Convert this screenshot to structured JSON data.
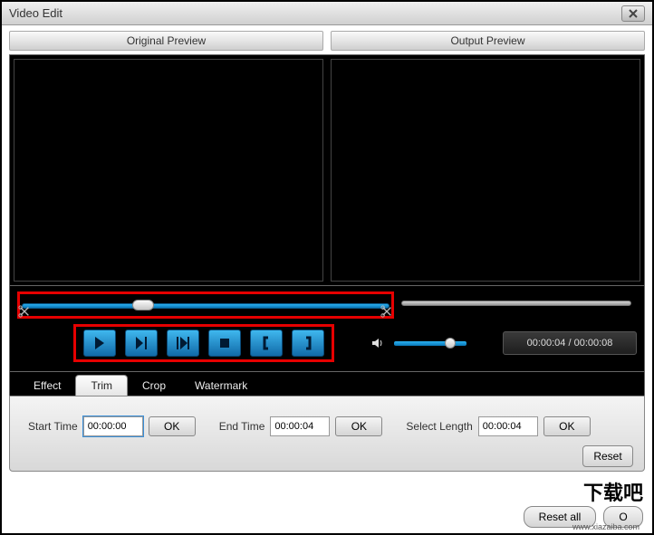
{
  "window": {
    "title": "Video Edit"
  },
  "preview": {
    "original_label": "Original Preview",
    "output_label": "Output Preview"
  },
  "playback": {
    "time_display": "00:00:04 / 00:00:08"
  },
  "tabs": {
    "effect": "Effect",
    "trim": "Trim",
    "crop": "Crop",
    "watermark": "Watermark"
  },
  "trim": {
    "start_label": "Start Time",
    "start_value": "00:00:00",
    "end_label": "End Time",
    "end_value": "00:00:04",
    "length_label": "Select Length",
    "length_value": "00:00:04",
    "ok": "OK",
    "reset": "Reset"
  },
  "footer": {
    "reset_all": "Reset all",
    "ok_partial": "O"
  },
  "watermark": {
    "logo": "下载吧",
    "url": "www.xiazaiba.com"
  }
}
